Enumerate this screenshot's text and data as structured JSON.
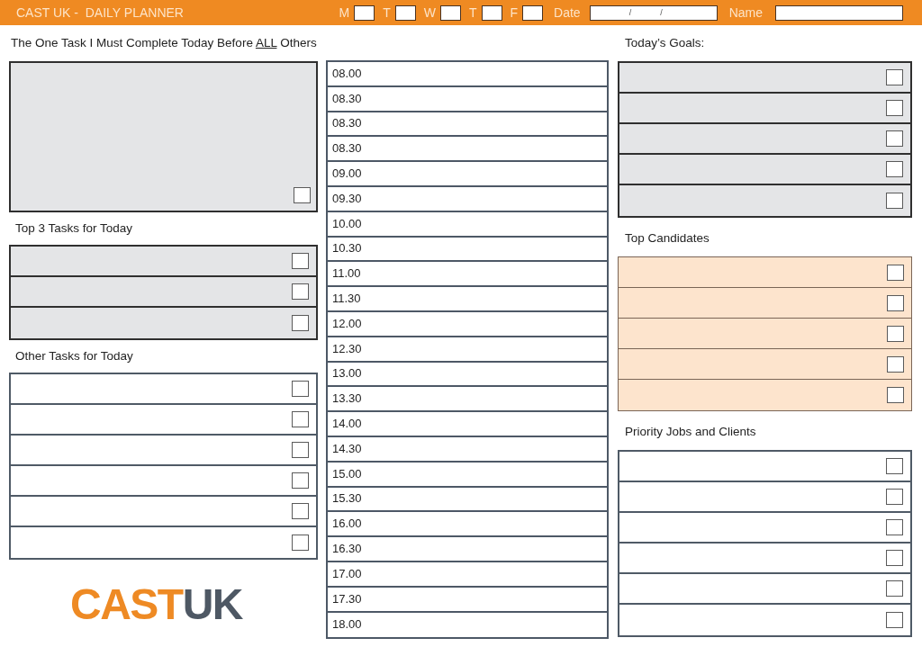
{
  "header": {
    "title": "CAST UK -  DAILY PLANNER",
    "days": [
      {
        "label": "M"
      },
      {
        "label": "T"
      },
      {
        "label": "W"
      },
      {
        "label": "T"
      },
      {
        "label": "F"
      }
    ],
    "date": {
      "label": "Date",
      "separators": [
        "/",
        "/"
      ]
    },
    "name": {
      "label": "Name"
    }
  },
  "left_column": [
    {
      "kind": "note",
      "title_parts": [
        {
          "text": "The One Task I Must Complete Today Before",
          "underlined": false
        },
        {
          "text": "ALL",
          "underlined": true
        },
        {
          "text": "Others",
          "underlined": false
        }
      ],
      "checked": false
    },
    {
      "kind": "shaded",
      "title": "Top 3 Tasks for Today",
      "rows": [
        {
          "checked": false
        },
        {
          "checked": false
        },
        {
          "checked": false
        }
      ]
    },
    {
      "kind": "plain",
      "title": "Other Tasks for Today",
      "rows": [
        {
          "checked": false
        },
        {
          "checked": false
        },
        {
          "checked": false
        },
        {
          "checked": false
        },
        {
          "checked": false
        },
        {
          "checked": false
        }
      ]
    }
  ],
  "logo": {
    "parts": [
      {
        "text": "CAST",
        "color": "#ee8a24"
      },
      {
        "text": "UK",
        "color": "#4e5864"
      }
    ]
  },
  "schedule": {
    "slots": [
      "08.00",
      "08.30",
      "08.30",
      "08.30",
      "09.00",
      "09.30",
      "10.00",
      "10.30",
      "11.00",
      "11.30",
      "12.00",
      "12.30",
      "13.00",
      "13.30",
      "14.00",
      "14.30",
      "15.00",
      "15.30",
      "16.00",
      "16.30",
      "17.00",
      "17.30",
      "18.00"
    ]
  },
  "right_column": [
    {
      "kind": "shaded",
      "title": "Today’s Goals:",
      "rows": [
        {
          "checked": false
        },
        {
          "checked": false
        },
        {
          "checked": false
        },
        {
          "checked": false
        },
        {
          "checked": false
        }
      ]
    },
    {
      "kind": "accent",
      "title": "Top Candidates",
      "rows": [
        {
          "checked": false
        },
        {
          "checked": false
        },
        {
          "checked": false
        },
        {
          "checked": false
        },
        {
          "checked": false
        }
      ]
    },
    {
      "kind": "plain",
      "title": "Priority Jobs and Clients",
      "rows": [
        {
          "checked": false
        },
        {
          "checked": false
        },
        {
          "checked": false
        },
        {
          "checked": false
        },
        {
          "checked": false
        },
        {
          "checked": false
        }
      ]
    }
  ]
}
